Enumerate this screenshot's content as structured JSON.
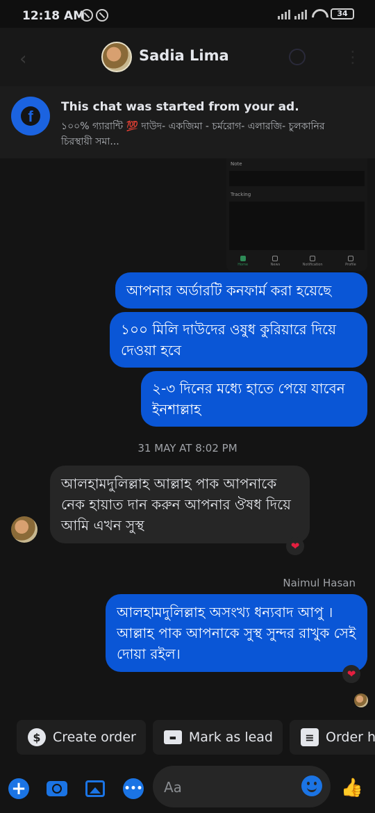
{
  "status_bar": {
    "time": "12:18 AM",
    "battery": "34"
  },
  "header": {
    "contact_name": "Sadia Lima"
  },
  "ad_banner": {
    "title": "This chat was started from your ad.",
    "description": "১০০% গ্যারান্টি 💯 দাউদ- একজিমা - চর্মরোগ-  এলারজি- চুলকানির চিরস্থায়ী সমা..."
  },
  "shared_screenshot": {
    "labels": [
      "Note",
      "Tracking"
    ],
    "nav": [
      "Home",
      "News",
      "Notification",
      "Profile"
    ]
  },
  "messages": [
    {
      "direction": "out",
      "text": "আপনার অর্ডারটি কনফার্ম করা হয়েছে"
    },
    {
      "direction": "out",
      "text": "১০০ মিলি দাউদের ওষুধ কুরিয়ারে দিয়ে দেওয়া হবে"
    },
    {
      "direction": "out",
      "text": "২-৩ দিনের মধ্যে হাতে পেয়ে যাবেন ইনশাল্লাহ"
    },
    {
      "direction": "in",
      "text": "আলহামদুলিল্লাহ আল্লাহ পাক আপনাকে নেক হায়াত দান করুন আপনার ঔষধ দিয়ে আমি এখন সুস্থ"
    },
    {
      "direction": "out",
      "text": "আলহামদুলিল্লাহ অসংখ্য ধন্যবাদ আপু । আল্লাহ পাক আপনাকে সুস্থ সুন্দর রাখুক সেই দোয়া রইল।"
    }
  ],
  "timestamp": "31 MAY AT 8:02 PM",
  "sender_name": "Naimul Hasan",
  "reaction_emoji": "❤",
  "quick_actions": [
    {
      "label": "Create order",
      "icon": "dollar-icon",
      "glyph": "$"
    },
    {
      "label": "Mark as lead",
      "icon": "contact-card-icon",
      "glyph": "▬"
    },
    {
      "label": "Order h",
      "icon": "order-list-icon",
      "glyph": "≡"
    }
  ],
  "composer": {
    "placeholder": "Aa"
  },
  "colors": {
    "outgoing_bubble": "#0a56d6",
    "accent": "#1b74e4",
    "background": "#141414"
  }
}
